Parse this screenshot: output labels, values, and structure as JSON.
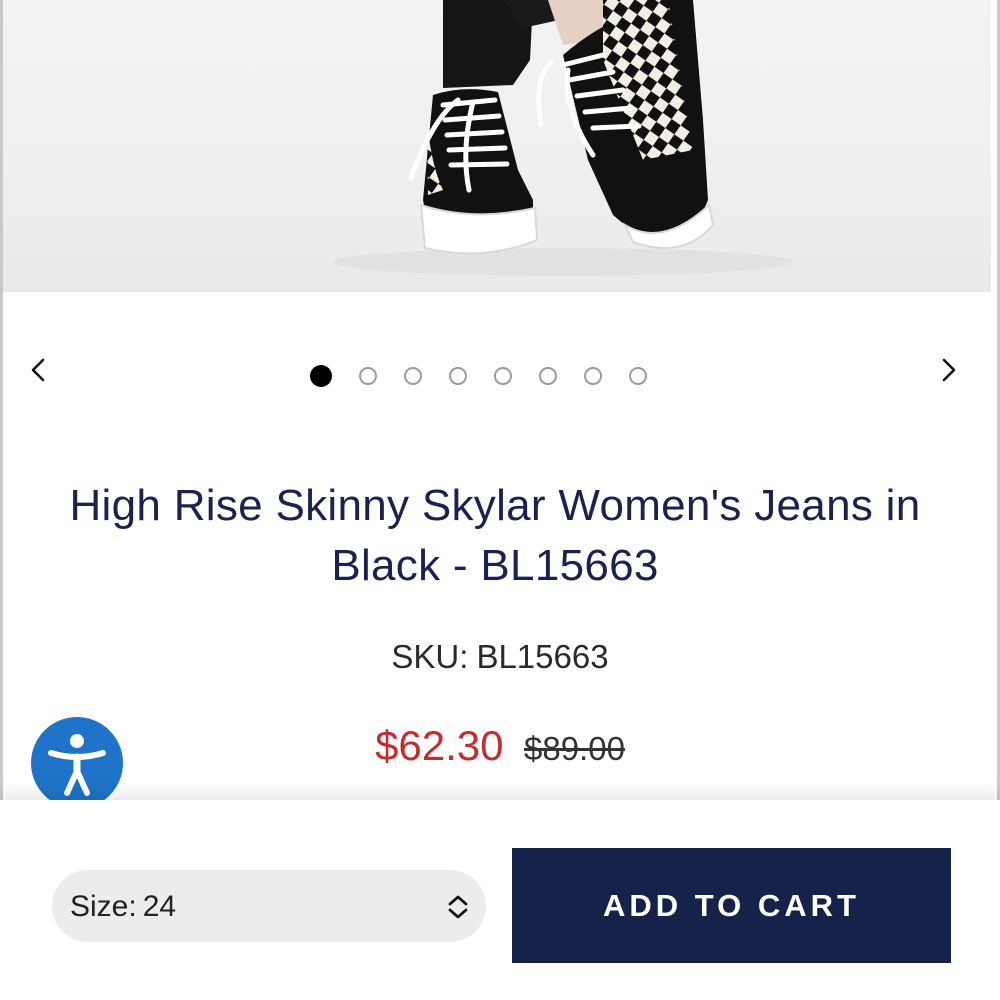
{
  "product": {
    "title": "High Rise Skinny Skylar Women's Jeans in Black - BL15663",
    "sku_label": "SKU:",
    "sku_value": "BL15663",
    "price_sale": "$62.30",
    "price_original": "$89.00"
  },
  "carousel": {
    "total_images": 8,
    "active_index": 0,
    "prev_icon": "chevron-left-icon",
    "next_icon": "chevron-right-icon"
  },
  "size_select": {
    "label": "Size:",
    "value": "24",
    "icon": "sort-chevrons-icon"
  },
  "cart": {
    "add_label": "ADD TO CART"
  },
  "accessibility": {
    "icon": "accessibility-person-icon"
  },
  "colors": {
    "title": "#1a2350",
    "sale_price": "#c62c2c",
    "button_bg": "#15224a",
    "accessibility_bg": "#1f73c8"
  }
}
